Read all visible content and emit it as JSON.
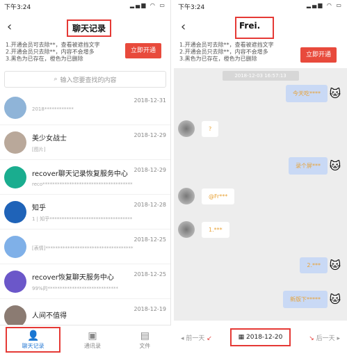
{
  "left": {
    "status_time": "下午3:24",
    "status_icons": "▂▄▆ ◠ ▭",
    "title": "聊天记录",
    "notice_lines": [
      "1.开通会员可去除**，查看被遮挡文字",
      "2.开通会员只去除**，内容不会增多",
      "3.黑色为已存在，橙色为已删除"
    ],
    "open_button": "立即开通",
    "search_placeholder": "输入您要查找的内容",
    "chats": [
      {
        "name": "",
        "preview": "2018************",
        "date": "2018-12-31",
        "avatar": "#8fb4d8"
      },
      {
        "name": "美少女战士",
        "preview": "[图片]",
        "date": "2018-12-29",
        "avatar": "#b9a89a"
      },
      {
        "name": "recover聊天记录恢复服务中心",
        "preview": "reco*************************************",
        "date": "2018-12-29",
        "avatar": "#1aad8f"
      },
      {
        "name": "知乎",
        "preview": "1 | 知乎**********************************",
        "date": "2018-12-28",
        "avatar": "#1f63b8"
      },
      {
        "name": "",
        "preview": "[表情]************************************",
        "date": "2018-12-25",
        "avatar": "#7fb0e8"
      },
      {
        "name": "recover恢复聊天服务中心",
        "preview": "99%的*****************************",
        "date": "2018-12-25",
        "avatar": "#6b57c9"
      },
      {
        "name": "人间不值得",
        "preview": "",
        "date": "2018-12-19",
        "avatar": "#8b7b72"
      }
    ],
    "tabs": [
      "聊天记录",
      "通讯录",
      "文件"
    ]
  },
  "right": {
    "status_time": "下午3:24",
    "status_icons": "▂▄▆ ◠ ▭",
    "title": "Frei.",
    "notice_lines": [
      "1.开通会员可去除**，查看被遮挡文字",
      "2.开通会员只去除**，内容不会增多",
      "3.黑色为已存在，橙色为已删除"
    ],
    "open_button": "立即开通",
    "timestamp": "2018-12-03 16:57:13",
    "messages": [
      "今天吃****",
      "?",
      "录个屏***",
      "@Fr***",
      "1.***",
      "2.***",
      "新版下*****"
    ],
    "prev_day": "前一天",
    "current_date": "2018-12-20",
    "next_day": "后一天"
  }
}
